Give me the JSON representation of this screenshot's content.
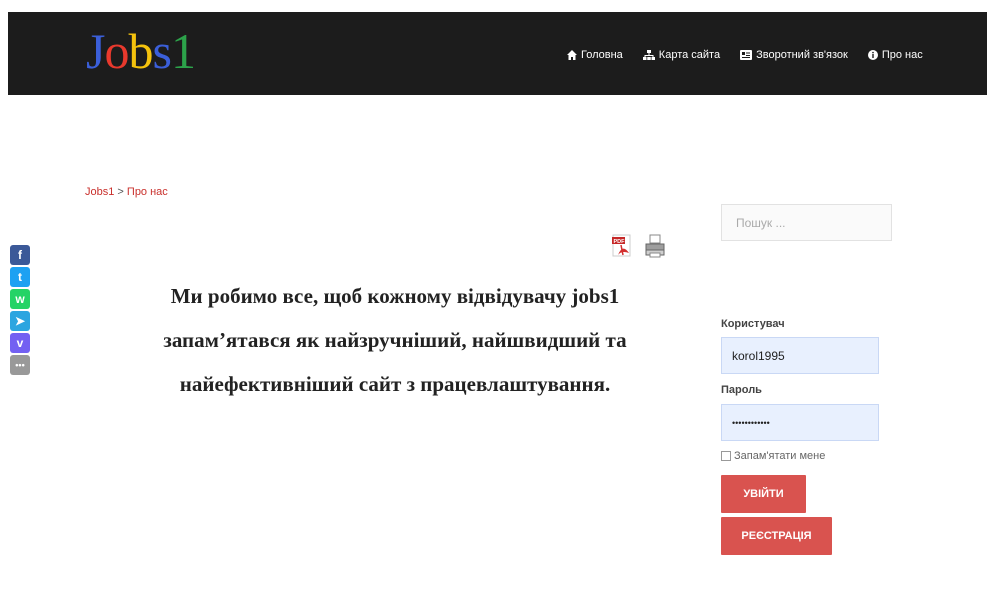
{
  "header": {
    "logo_letters": [
      "J",
      "o",
      "b",
      "s",
      "1"
    ],
    "logo_colors": [
      "#3b5fd9",
      "#e8392d",
      "#f4c20d",
      "#3b5fd9",
      "#2ca24a"
    ],
    "nav": [
      {
        "label": "Головна",
        "icon": "home-icon"
      },
      {
        "label": "Карта сайта",
        "icon": "sitemap-icon"
      },
      {
        "label": "Зворотний зв'язок",
        "icon": "contact-card-icon"
      },
      {
        "label": "Про нас",
        "icon": "info-icon"
      }
    ]
  },
  "breadcrumb": {
    "home": "Jobs1",
    "separator": " > ",
    "current": "Про нас"
  },
  "content": {
    "headline": "Ми робимо все, щоб кожному відвідувачу jobs1 запам’ятався як найзручніший, найшвидший та найефективніший сайт з працевлаштування."
  },
  "share_icons": [
    {
      "name": "facebook-share-icon",
      "color": "#3b5998",
      "glyph": "f"
    },
    {
      "name": "twitter-share-icon",
      "color": "#1da1f2",
      "glyph": "t"
    },
    {
      "name": "whatsapp-share-icon",
      "color": "#25d366",
      "glyph": "w"
    },
    {
      "name": "telegram-share-icon",
      "color": "#2ca5e0",
      "glyph": "➤"
    },
    {
      "name": "viber-share-icon",
      "color": "#7360f2",
      "glyph": "v"
    },
    {
      "name": "more-share-icon",
      "color": "#999999",
      "glyph": "•••"
    }
  ],
  "sidebar": {
    "search_placeholder": "Пошук ...",
    "username_label": "Користувач",
    "username_value": "korol1995",
    "password_label": "Пароль",
    "password_value": "••••••••••••",
    "remember_label": "Запам'ятати мене",
    "login_button": "УВІЙТИ",
    "register_button": "РЕЄСТРАЦІЯ"
  },
  "colors": {
    "accent": "#d9534f",
    "topbar": "#1c1c1c",
    "link": "#c9302c"
  }
}
